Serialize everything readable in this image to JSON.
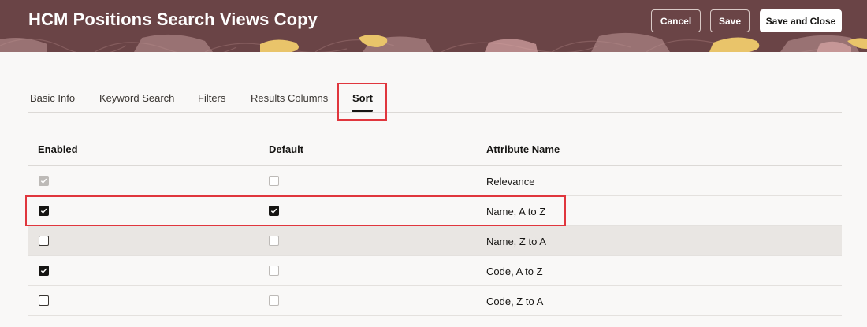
{
  "header": {
    "title": "HCM Positions Search Views Copy",
    "buttons": {
      "cancel": "Cancel",
      "save": "Save",
      "save_and_close": "Save and Close"
    },
    "colors": {
      "banner": "#6a4446",
      "accent": "#e9c46a"
    }
  },
  "tabs": [
    {
      "label": "Basic Info",
      "active": false
    },
    {
      "label": "Keyword Search",
      "active": false
    },
    {
      "label": "Filters",
      "active": false
    },
    {
      "label": "Results Columns",
      "active": false
    },
    {
      "label": "Sort",
      "active": true
    }
  ],
  "table": {
    "columns": {
      "enabled": "Enabled",
      "default": "Default",
      "attribute": "Attribute Name"
    },
    "rows": [
      {
        "enabled": "checked",
        "enabled_disabled": true,
        "default": "unchecked",
        "default_disabled": true,
        "attribute": "Relevance"
      },
      {
        "enabled": "checked",
        "enabled_disabled": false,
        "default": "checked",
        "default_disabled": false,
        "attribute": "Name, A to Z"
      },
      {
        "enabled": "unchecked",
        "enabled_disabled": false,
        "default": "unchecked",
        "default_disabled": true,
        "attribute": "Name, Z to A"
      },
      {
        "enabled": "checked",
        "enabled_disabled": false,
        "default": "unchecked",
        "default_disabled": true,
        "attribute": "Code, A to Z"
      },
      {
        "enabled": "unchecked",
        "enabled_disabled": false,
        "default": "unchecked",
        "default_disabled": true,
        "attribute": "Code, Z to A"
      }
    ]
  }
}
